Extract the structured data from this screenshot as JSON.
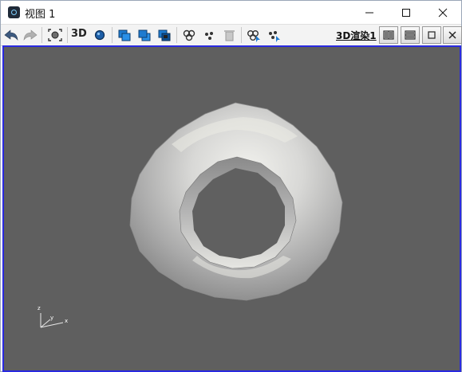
{
  "window": {
    "title": "视图 1"
  },
  "toolbar": {
    "mode_3d_label": "3D",
    "render_link_label": "3D渲染1"
  },
  "colors": {
    "viewport_background": "#5f5f5f",
    "viewport_border": "#2a2ae0",
    "accent_blue": "#1e7bd0"
  },
  "axis_triad": {
    "z_label": "z",
    "y_label": "y",
    "x_label": "x"
  }
}
